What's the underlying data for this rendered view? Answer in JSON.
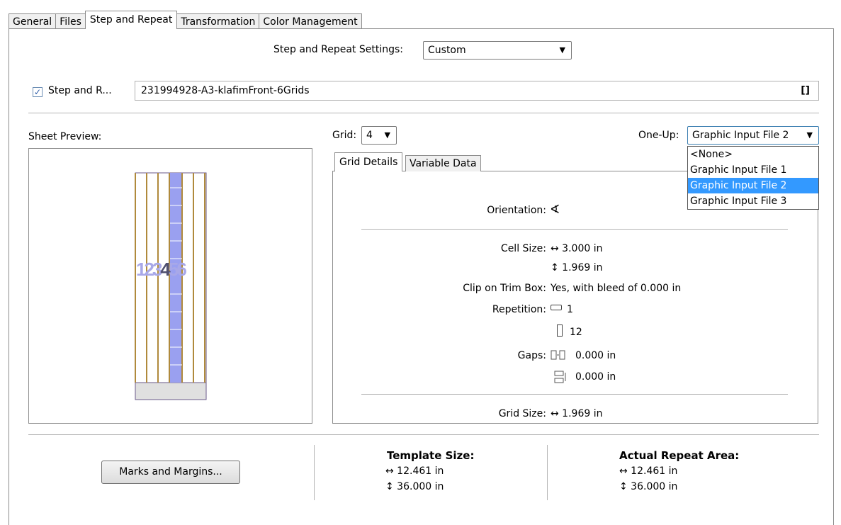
{
  "tabs": [
    "General",
    "Files",
    "Step and Repeat",
    "Transformation",
    "Color Management"
  ],
  "settings": {
    "label": "Step and Repeat Settings:",
    "value": "Custom"
  },
  "step_repeat": {
    "checkbox_label": "Step and R...",
    "checked": true,
    "file_value": "231994928-A3-klafimFront-6Grids",
    "bracket_icon": "[]"
  },
  "sheet_preview": {
    "label": "Sheet Preview:",
    "numbers": [
      "1",
      "2",
      "3",
      "4",
      "5",
      "6"
    ],
    "active_number": "4"
  },
  "grid": {
    "label": "Grid:",
    "value": "4"
  },
  "oneup": {
    "label": "One-Up:",
    "value": "Graphic Input File 2",
    "options": [
      "<None>",
      "Graphic Input File 1",
      "Graphic Input File 2",
      "Graphic Input File 3"
    ],
    "selected_index": 2
  },
  "subtabs": [
    "Grid Details",
    "Variable Data"
  ],
  "details": {
    "orientation_label": "Orientation:",
    "orientation_icon": "∢",
    "cell_size_label": "Cell Size:",
    "cell_width": "↔ 3.000 in",
    "cell_height": "↕ 1.969 in",
    "clip_label": "Clip on Trim Box:",
    "clip_value": "Yes, with bleed of 0.000 in",
    "repetition_label": "Repetition:",
    "rep_horizontal": "1",
    "rep_vertical": "12",
    "gaps_label": "Gaps:",
    "gap_horizontal": "0.000 in",
    "gap_vertical": "0.000 in",
    "grid_size_label": "Grid Size:",
    "grid_size_value": "↔ 1.969 in"
  },
  "marks_button": "Marks and Margins...",
  "template": {
    "title": "Template Size:",
    "width": "↔ 12.461 in",
    "height": "↕ 36.000 in"
  },
  "repeat_area": {
    "title": "Actual Repeat Area:",
    "width": "↔ 12.461 in",
    "height": "↕ 36.000 in"
  },
  "colors": {
    "selection": "#3399ff",
    "preview_column": "#9aa0f0",
    "preview_lines": "#b08a3c"
  }
}
